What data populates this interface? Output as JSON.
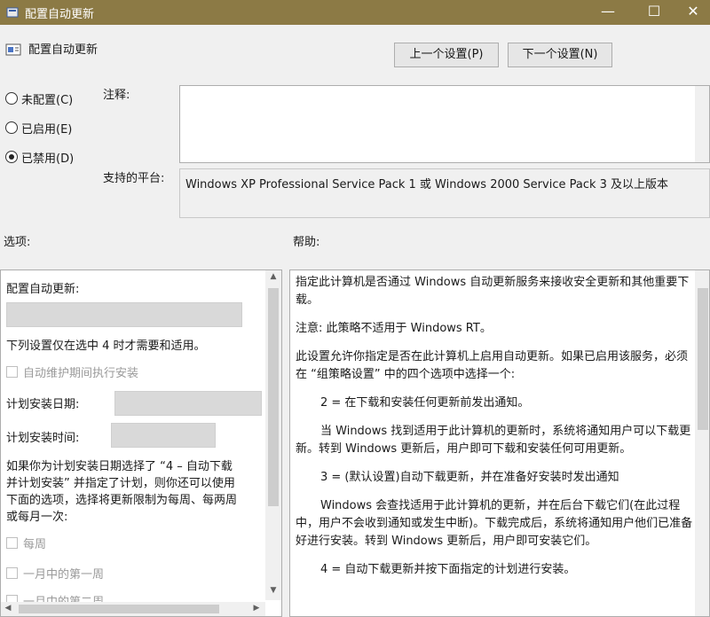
{
  "window": {
    "title": "配置自动更新",
    "minimize": "—",
    "maximize": "☐",
    "close": "✕"
  },
  "header": {
    "title": "配置自动更新",
    "prev_button": "上一个设置(P)",
    "next_button": "下一个设置(N)"
  },
  "state": {
    "options": [
      {
        "label": "未配置(C)",
        "checked": false
      },
      {
        "label": "已启用(E)",
        "checked": false
      },
      {
        "label": "已禁用(D)",
        "checked": true
      }
    ]
  },
  "comment": {
    "label": "注释:",
    "value": ""
  },
  "platform": {
    "label": "支持的平台:",
    "value": "Windows XP Professional Service Pack 1 或 Windows 2000 Service Pack 3 及以上版本"
  },
  "options_panel": {
    "label": "选项:",
    "configure_label": "配置自动更新:",
    "configure_value": "",
    "only_when_4": "下列设置仅在选中 4 时才需要和适用。",
    "maintenance_checkbox": "自动维护期间执行安装",
    "install_day_label": "计划安装日期:",
    "install_day_value": "",
    "install_time_label": "计划安装时间:",
    "install_time_value": "",
    "explain_lines": [
      "如果你为计划安装日期选择了 “4 – 自动下载",
      "并计划安装” 并指定了计划，则你还可以使用",
      "下面的选项，选择将更新限制为每周、每两周",
      "或每月一次:"
    ],
    "weekly_checkbox": "每周",
    "first_week_checkbox": "一月中的第一周",
    "second_week_checkbox": "一月中的第二周"
  },
  "help_panel": {
    "label": "帮助:",
    "paragraphs": [
      "指定此计算机是否通过 Windows 自动更新服务来接收安全更新和其他重要下载。",
      "注意: 此策略不适用于 Windows RT。",
      "此设置允许你指定是否在此计算机上启用自动更新。如果已启用该服务，必须在 “组策略设置” 中的四个选项中选择一个:",
      "2 = 在下载和安装任何更新前发出通知。",
      "当 Windows 找到适用于此计算机的更新时，系统将通知用户可以下载更新。转到 Windows 更新后，用户即可下载和安装任何可用更新。",
      "3 = (默认设置)自动下载更新，并在准备好安装时发出通知",
      "Windows 会查找适用于此计算机的更新，并在后台下载它们(在此过程中，用户不会收到通知或发生中断)。下载完成后，系统将通知用户他们已准备好进行安装。转到 Windows 更新后，用户即可安装它们。",
      "4 = 自动下载更新并按下面指定的计划进行安装。"
    ]
  },
  "colors": {
    "titlebar": "#8c7a45",
    "background": "#f0f0f0",
    "panel": "#ffffff"
  }
}
